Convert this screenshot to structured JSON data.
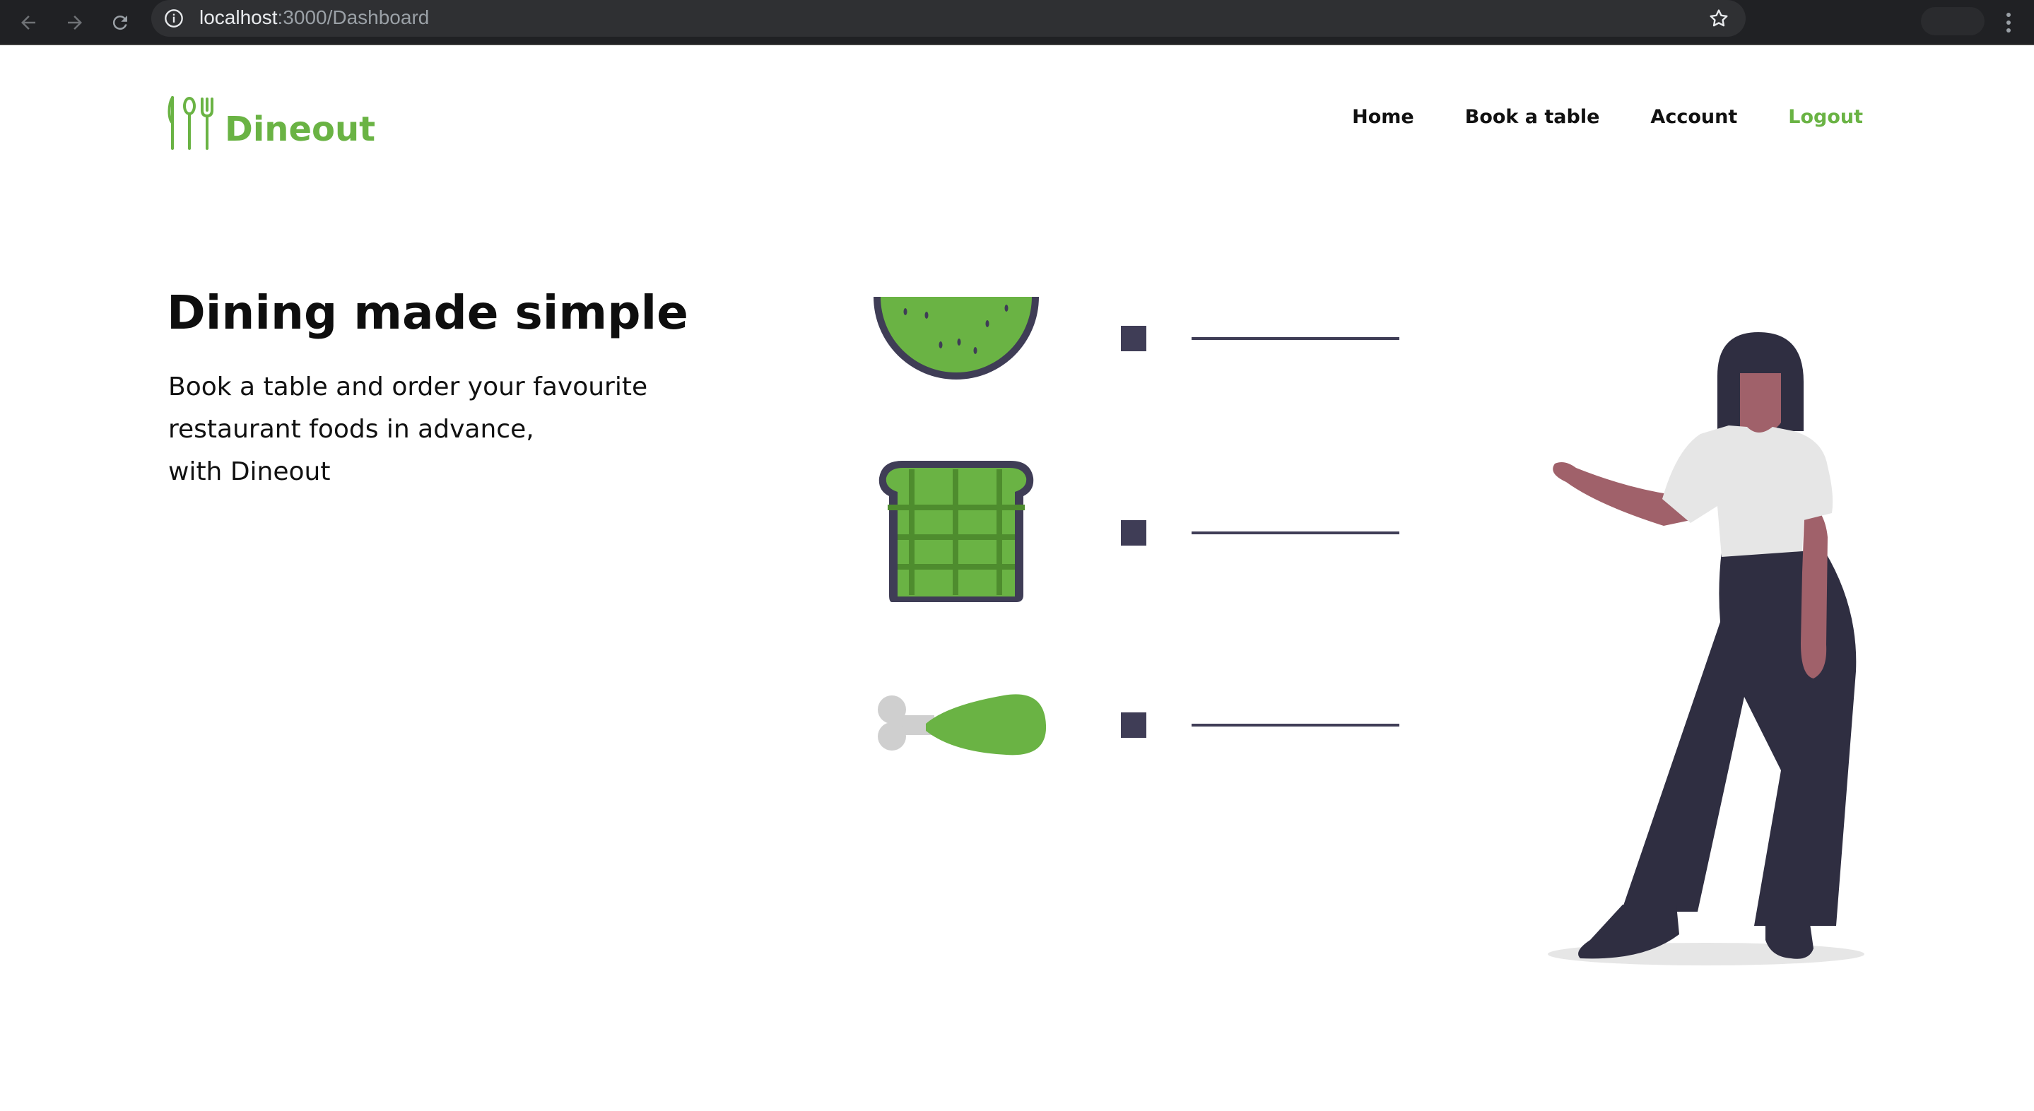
{
  "browser": {
    "url_host": "localhost",
    "url_path": ":3000/Dashboard",
    "icons": [
      "back-arrow-icon",
      "forward-arrow-icon",
      "reload-icon",
      "info-icon",
      "star-icon",
      "more-vert-icon"
    ]
  },
  "header": {
    "brand": "Dineout",
    "logo_icon": "cutlery-icon",
    "nav": [
      {
        "label": "Home"
      },
      {
        "label": "Book a table"
      },
      {
        "label": "Account"
      },
      {
        "label": "Logout"
      }
    ]
  },
  "hero": {
    "title": "Dining made simple",
    "lines": [
      "Book a table and order your favourite",
      "restaurant foods in advance,",
      "with Dineout"
    ]
  },
  "colors": {
    "brand_green": "#6ab344",
    "dark": "#3f3d56",
    "text": "#111111"
  }
}
